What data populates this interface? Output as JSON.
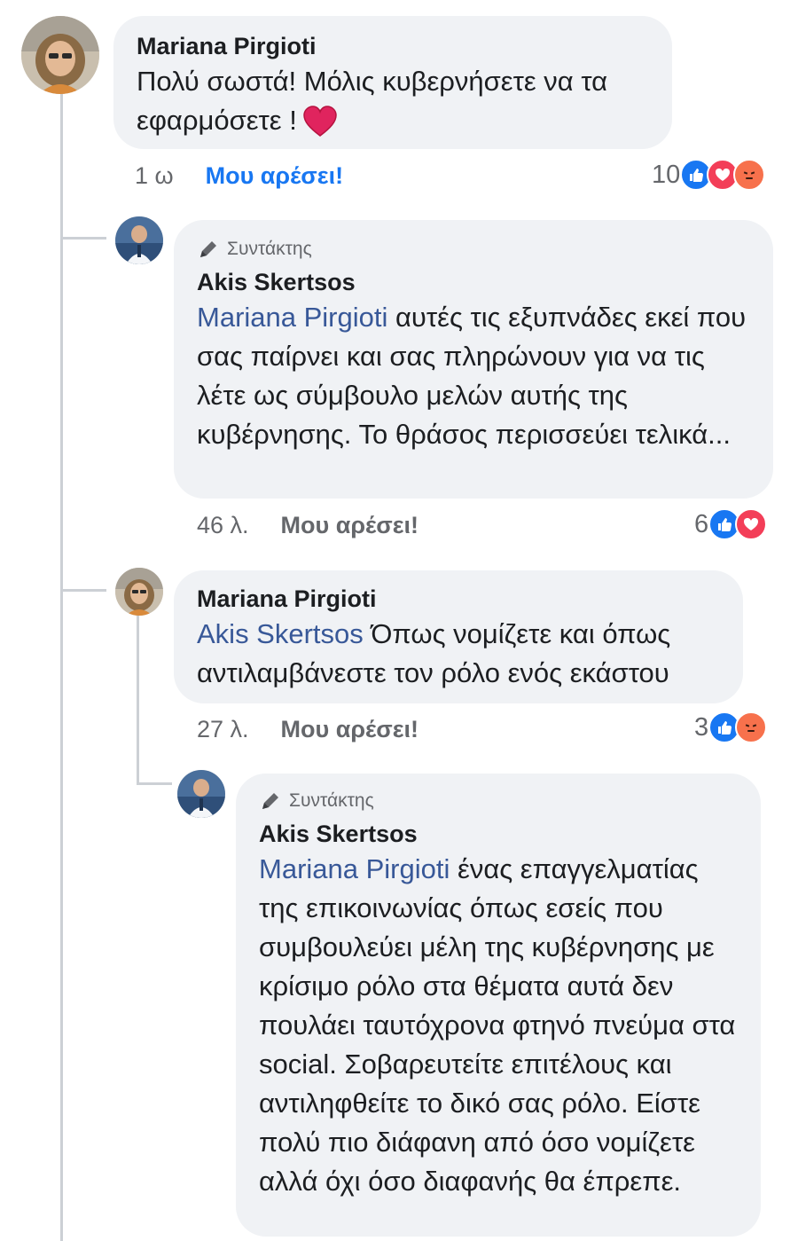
{
  "comments": [
    {
      "author": "Mariana Pirgioti",
      "mention": "",
      "text": "Πολύ σωστά! Μόλις κυβερνήσετε να τα εφαρμόσετε !",
      "time": "1 ω",
      "like_label": "Μου αρέσει!",
      "reaction_count": "10",
      "reactions": [
        "like-icon",
        "love-icon",
        "angry-icon"
      ]
    },
    {
      "badge": "Συντάκτης",
      "author": "Akis Skertsos",
      "mention": "Mariana Pirgioti",
      "text": "αυτές τις εξυπνάδες εκεί που σας παίρνει και σας πληρώνουν για να τις λέτε ως σύμβουλο μελών αυτής της κυβέρνησης. Το θράσος περισσεύει τελικά...",
      "time": "46 λ.",
      "like_label": "Μου αρέσει!",
      "reaction_count": "6",
      "reactions": [
        "like-icon",
        "love-icon"
      ]
    },
    {
      "author": "Mariana Pirgioti",
      "mention": "Akis Skertsos",
      "text": "Όπως νομίζετε και όπως αντιλαμβάνεστε τον ρόλο ενός εκάστου",
      "time": "27 λ.",
      "like_label": "Μου αρέσει!",
      "reaction_count": "3",
      "reactions": [
        "like-icon",
        "angry-icon"
      ]
    },
    {
      "badge": "Συντάκτης",
      "author": "Akis Skertsos",
      "mention": "Mariana Pirgioti",
      "text": "ένας επαγγελματίας της επικοινωνίας όπως εσείς που συμβουλεύει μέλη της κυβέρνησης με κρίσιμο ρόλο στα θέματα αυτά δεν πουλάει ταυτόχρονα φτηνό πνεύμα στα social. Σοβαρευτείτε επιτέλους και αντιληφθείτε το δικό σας ρόλο. Είστε πολύ πιο διάφανη από όσο νομίζετε αλλά όχι όσο διαφανής θα έπρεπε."
    }
  ],
  "colors": {
    "bubble": "#f0f2f5",
    "mention": "#385898",
    "like_blue": "#1877f2",
    "love_red": "#f33e58",
    "angry_orange": "#f7714c",
    "meta_gray": "#65676b"
  }
}
